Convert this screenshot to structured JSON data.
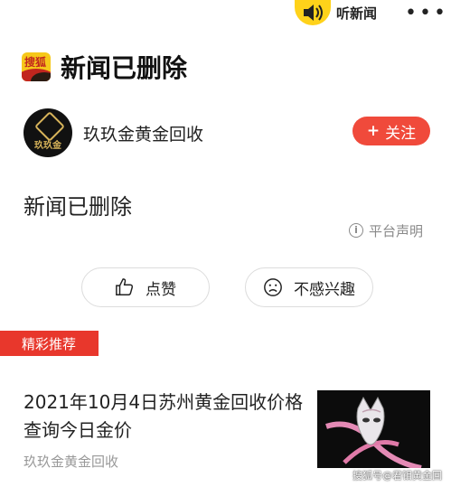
{
  "topbar": {
    "listen_label": "听新闻",
    "more_label": "•••"
  },
  "header": {
    "logo_text": "搜狐",
    "title": "新闻已删除"
  },
  "author": {
    "avatar_text": "玖玖金",
    "name": "玖玖金黄金回收",
    "follow_label": "关注",
    "follow_plus": "+"
  },
  "article": {
    "body": "新闻已删除",
    "platform_statement": "平台声明",
    "info_glyph": "i"
  },
  "actions": {
    "like_label": "点赞",
    "dislike_label": "不感兴趣"
  },
  "recommend": {
    "badge": "精彩推荐",
    "items": [
      {
        "title": "2021年10月4日苏州黄金回收价格查询今日金价",
        "source": "玖玖金黄金回收"
      }
    ]
  },
  "watermark": "搜狐号@君钼黄金回",
  "colors": {
    "accent_red": "#e8372c",
    "follow_red": "#f04a3b",
    "listen_yellow": "#ffd21a",
    "muted_gray": "#8a8a8a"
  },
  "icons": [
    "speaker-icon",
    "more-icon",
    "sohu-logo",
    "info-icon",
    "thumbs-up-icon",
    "sad-face-icon"
  ]
}
